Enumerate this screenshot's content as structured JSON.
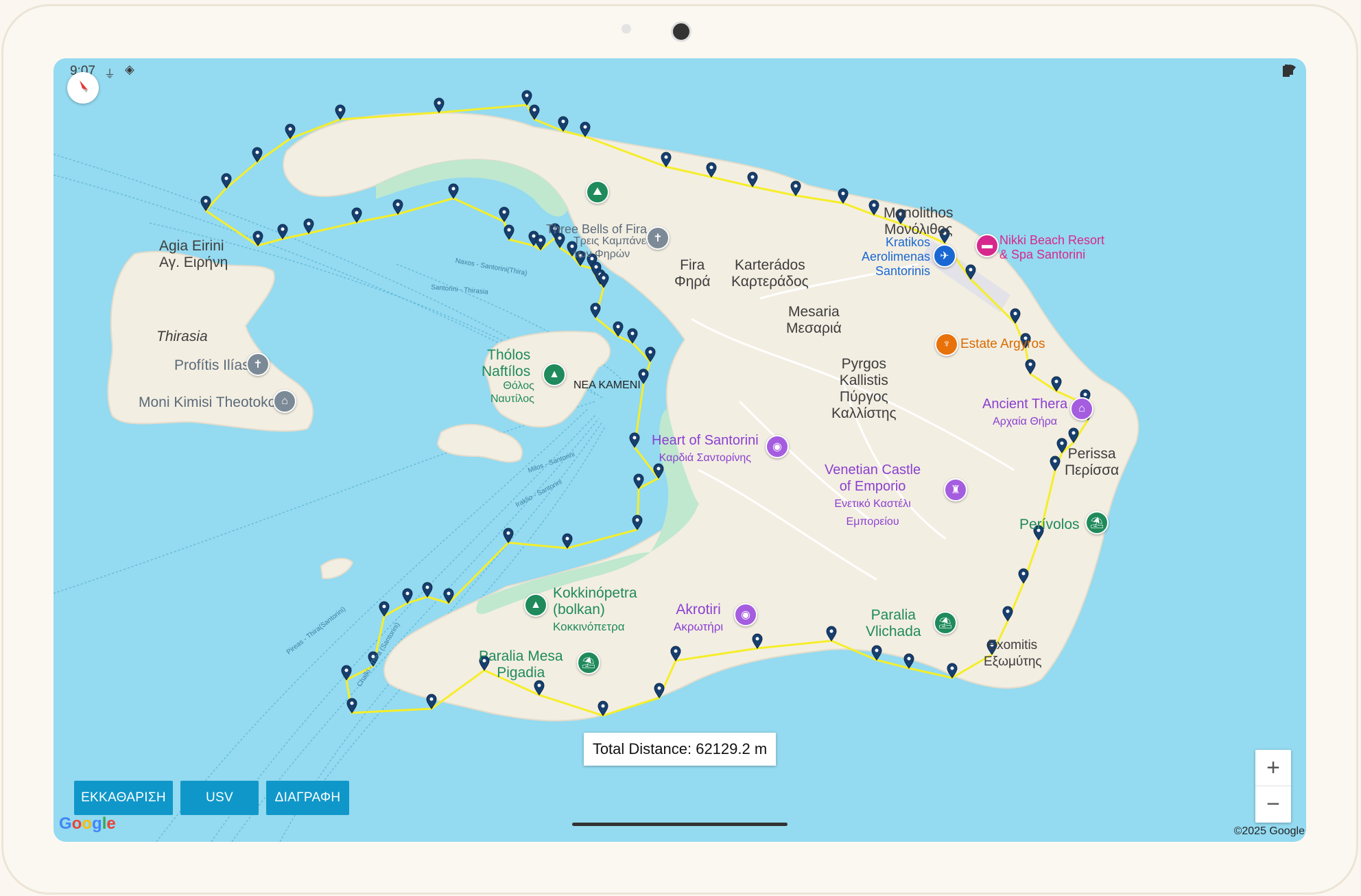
{
  "status": {
    "time": "9:07"
  },
  "map": {
    "labels": {
      "agia_eirini": "Agia Eirini",
      "agia_eirini_gr": "Αγ. Ειρήνη",
      "thirasia": "Thirasia",
      "profitis_ilias": "Profítis Ilías",
      "moni_kimisi": "Moni Kimisi Theotokou",
      "tholos": "Thólos",
      "naftilos": "Naftílos",
      "tholos_gr": "Θόλος",
      "naftilos_gr": "Ναυτίλος",
      "nea_kameni": "NEA KAMENI",
      "three_bells": "Three Bells of Fira",
      "three_bells_gr1": "Τρεις Καμπάνες",
      "three_bells_gr2": "των Φηρών",
      "fira": "Fira",
      "fira_gr": "Φηρά",
      "karterados": "Karterádos",
      "karterados_gr": "Καρτεράδος",
      "mesaria": "Mesaria",
      "mesaria_gr": "Μεσαριά",
      "monolithos": "Monolithos",
      "monolithos_gr": "Μονόλιθος",
      "airport1": "Kratikos",
      "airport2": "Aerolimenas",
      "airport3": "Santorinis",
      "nikki1": "Nikki Beach Resort",
      "nikki2": "& Spa Santorini",
      "estate_argyros": "Estate Argyros",
      "pyrgos1": "Pyrgos",
      "pyrgos2": "Kallistis",
      "pyrgos3": "Πύργος",
      "pyrgos4": "Καλλίστης",
      "ancient_thera": "Ancient Thera",
      "ancient_thera_gr": "Αρχαία Θήρα",
      "heart1": "Heart of Santorini",
      "heart2": "Καρδιά Σαντορίνης",
      "venetian1": "Venetian Castle",
      "venetian2": "of Emporio",
      "venetian3": "Ενετικό Καστέλι",
      "venetian4": "Εμπορείου",
      "perissa": "Perissa",
      "perissa_gr": "Περίσσα",
      "perivolos": "Perívolos",
      "kokkinopetra1": "Kokkinópetra",
      "kokkinopetra2": "(bolkan)",
      "kokkinopetra3": "Κοκκινόπετρα",
      "akrotiri": "Akrotiri",
      "akrotiri_gr": "Ακρωτήρι",
      "paralia_vlichada1": "Paralia",
      "paralia_vlichada2": "Vlichada",
      "paralia_mesa1": "Paralia Mesa",
      "paralia_mesa2": "Pigadia",
      "exomitis": "Exomitis",
      "exomitis_gr": "Εξωμύτης",
      "ferry1": "Naxos - Santorini(Thira)",
      "ferry2": "Santorini - Thirasia",
      "ferry3": "Milos - Santorini",
      "ferry4": "Iraklio - Santorini",
      "ferry5": "Pireas - Thira(Santorini)",
      "ferry6": "Chalki - Thira (Santorini)"
    }
  },
  "overlay": {
    "total_distance": "Total Distance: 62129.2 m"
  },
  "buttons": {
    "clear": "ΕΚΚΑΘΑΡΙΣΗ",
    "usv": "USV",
    "delete": "ΔΙΑΓΡΑΦΗ"
  },
  "zoom": {
    "in": "+",
    "out": "−"
  },
  "attribution": {
    "google": "Google",
    "copyright": "©2025 Google"
  },
  "colors": {
    "sea": "#94daf0",
    "land": "#f3eee2",
    "route": "#f5ee2a",
    "marker": "#173f6e",
    "button": "#1097c9"
  }
}
